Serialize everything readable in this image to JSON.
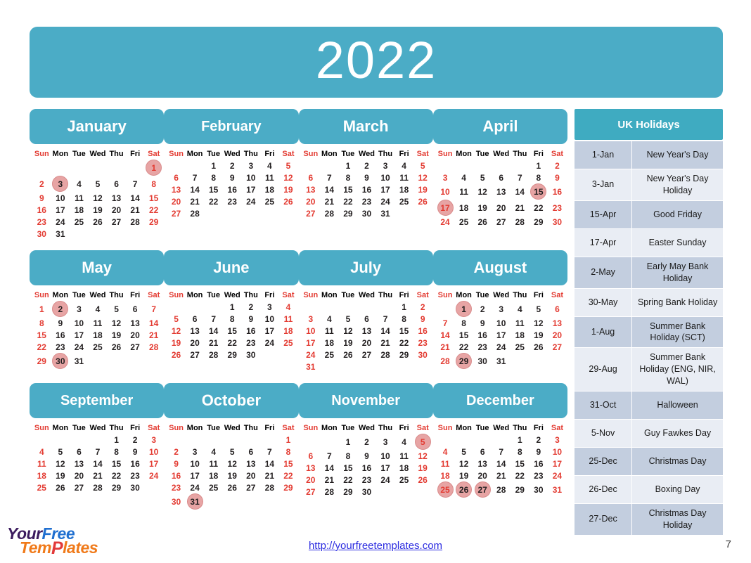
{
  "banner": {
    "year": "2022"
  },
  "weekday_headers": [
    "Sun",
    "Mon",
    "Tue",
    "Wed",
    "Thu",
    "Fri",
    "Sat"
  ],
  "months": [
    {
      "name": "January",
      "weeks": [
        [
          null,
          null,
          null,
          null,
          null,
          null,
          1
        ],
        [
          2,
          3,
          4,
          5,
          6,
          7,
          8
        ],
        [
          9,
          10,
          11,
          12,
          13,
          14,
          15
        ],
        [
          16,
          17,
          18,
          19,
          20,
          21,
          22
        ],
        [
          23,
          24,
          25,
          26,
          27,
          28,
          29
        ],
        [
          30,
          31,
          null,
          null,
          null,
          null,
          null
        ]
      ],
      "highlighted": [
        1,
        3
      ]
    },
    {
      "name": "February",
      "weeks": [
        [
          null,
          null,
          1,
          2,
          3,
          4,
          5
        ],
        [
          6,
          7,
          8,
          9,
          10,
          11,
          12
        ],
        [
          13,
          14,
          15,
          16,
          17,
          18,
          19
        ],
        [
          20,
          21,
          22,
          23,
          24,
          25,
          26
        ],
        [
          27,
          28,
          null,
          null,
          null,
          null,
          null
        ]
      ],
      "highlighted": []
    },
    {
      "name": "March",
      "weeks": [
        [
          null,
          null,
          1,
          2,
          3,
          4,
          5
        ],
        [
          6,
          7,
          8,
          9,
          10,
          11,
          12
        ],
        [
          13,
          14,
          15,
          16,
          17,
          18,
          19
        ],
        [
          20,
          21,
          22,
          23,
          24,
          25,
          26
        ],
        [
          27,
          28,
          29,
          30,
          31,
          null,
          null
        ]
      ],
      "highlighted": []
    },
    {
      "name": "April",
      "weeks": [
        [
          null,
          null,
          null,
          null,
          null,
          1,
          2
        ],
        [
          3,
          4,
          5,
          6,
          7,
          8,
          9
        ],
        [
          10,
          11,
          12,
          13,
          14,
          15,
          16
        ],
        [
          17,
          18,
          19,
          20,
          21,
          22,
          23
        ],
        [
          24,
          25,
          26,
          27,
          28,
          29,
          30
        ]
      ],
      "highlighted": [
        15,
        17
      ]
    },
    {
      "name": "May",
      "weeks": [
        [
          1,
          2,
          3,
          4,
          5,
          6,
          7
        ],
        [
          8,
          9,
          10,
          11,
          12,
          13,
          14
        ],
        [
          15,
          16,
          17,
          18,
          19,
          20,
          21
        ],
        [
          22,
          23,
          24,
          25,
          26,
          27,
          28
        ],
        [
          29,
          30,
          31,
          null,
          null,
          null,
          null
        ]
      ],
      "highlighted": [
        2,
        30
      ]
    },
    {
      "name": "June",
      "weeks": [
        [
          null,
          null,
          null,
          1,
          2,
          3,
          4
        ],
        [
          5,
          6,
          7,
          8,
          9,
          10,
          11
        ],
        [
          12,
          13,
          14,
          15,
          16,
          17,
          18
        ],
        [
          19,
          20,
          21,
          22,
          23,
          24,
          25
        ],
        [
          26,
          27,
          28,
          29,
          30,
          null,
          null
        ]
      ],
      "highlighted": []
    },
    {
      "name": "July",
      "weeks": [
        [
          null,
          null,
          null,
          null,
          null,
          1,
          2
        ],
        [
          3,
          4,
          5,
          6,
          7,
          8,
          9
        ],
        [
          10,
          11,
          12,
          13,
          14,
          15,
          16
        ],
        [
          17,
          18,
          19,
          20,
          21,
          22,
          23
        ],
        [
          24,
          25,
          26,
          27,
          28,
          29,
          30
        ],
        [
          31,
          null,
          null,
          null,
          null,
          null,
          null
        ]
      ],
      "highlighted": []
    },
    {
      "name": "August",
      "weeks": [
        [
          null,
          1,
          2,
          3,
          4,
          5,
          6
        ],
        [
          7,
          8,
          9,
          10,
          11,
          12,
          13
        ],
        [
          14,
          15,
          16,
          17,
          18,
          19,
          20
        ],
        [
          21,
          22,
          23,
          24,
          25,
          26,
          27
        ],
        [
          28,
          29,
          30,
          31,
          null,
          null,
          null
        ]
      ],
      "highlighted": [
        1,
        29
      ]
    },
    {
      "name": "September",
      "weeks": [
        [
          null,
          null,
          null,
          null,
          1,
          2,
          3
        ],
        [
          4,
          5,
          6,
          7,
          8,
          9,
          10
        ],
        [
          11,
          12,
          13,
          14,
          15,
          16,
          17
        ],
        [
          18,
          19,
          20,
          21,
          22,
          23,
          24
        ],
        [
          25,
          26,
          27,
          28,
          29,
          30,
          null
        ]
      ],
      "highlighted": []
    },
    {
      "name": "October",
      "weeks": [
        [
          null,
          null,
          null,
          null,
          null,
          null,
          1
        ],
        [
          2,
          3,
          4,
          5,
          6,
          7,
          8
        ],
        [
          9,
          10,
          11,
          12,
          13,
          14,
          15
        ],
        [
          16,
          17,
          18,
          19,
          20,
          21,
          22
        ],
        [
          23,
          24,
          25,
          26,
          27,
          28,
          29
        ],
        [
          30,
          31,
          null,
          null,
          null,
          null,
          null
        ]
      ],
      "highlighted": [
        31
      ]
    },
    {
      "name": "November",
      "weeks": [
        [
          null,
          null,
          1,
          2,
          3,
          4,
          5
        ],
        [
          6,
          7,
          8,
          9,
          10,
          11,
          12
        ],
        [
          13,
          14,
          15,
          16,
          17,
          18,
          19
        ],
        [
          20,
          21,
          22,
          23,
          24,
          25,
          26
        ],
        [
          27,
          28,
          29,
          30,
          null,
          null,
          null
        ]
      ],
      "highlighted": [
        5
      ]
    },
    {
      "name": "December",
      "weeks": [
        [
          null,
          null,
          null,
          null,
          1,
          2,
          3
        ],
        [
          4,
          5,
          6,
          7,
          8,
          9,
          10
        ],
        [
          11,
          12,
          13,
          14,
          15,
          16,
          17
        ],
        [
          18,
          19,
          20,
          21,
          22,
          23,
          24
        ],
        [
          25,
          26,
          27,
          28,
          29,
          30,
          31
        ]
      ],
      "highlighted": [
        25,
        26,
        27
      ]
    }
  ],
  "holidays": {
    "title": "UK Holidays",
    "rows": [
      {
        "date": "1-Jan",
        "name": "New Year's Day"
      },
      {
        "date": "3-Jan",
        "name": "New Year's Day Holiday"
      },
      {
        "date": "15-Apr",
        "name": "Good Friday"
      },
      {
        "date": "17-Apr",
        "name": "Easter Sunday"
      },
      {
        "date": "2-May",
        "name": "Early May Bank Holiday"
      },
      {
        "date": "30-May",
        "name": "Spring Bank Holiday"
      },
      {
        "date": "1-Aug",
        "name": "Summer Bank Holiday (SCT)"
      },
      {
        "date": "29-Aug",
        "name": "Summer Bank Holiday (ENG, NIR, WAL)"
      },
      {
        "date": "31-Oct",
        "name": "Halloween"
      },
      {
        "date": "5-Nov",
        "name": "Guy Fawkes Day"
      },
      {
        "date": "25-Dec",
        "name": "Christmas Day"
      },
      {
        "date": "26-Dec",
        "name": "Boxing Day"
      },
      {
        "date": "27-Dec",
        "name": "Christmas Day Holiday"
      }
    ]
  },
  "footer": {
    "logo_line1_a": "Your",
    "logo_line1_b": "Free",
    "logo_line2_a": "Tem",
    "logo_line2_p": "P",
    "logo_line2_b": "lates",
    "url": "http://yourfreetemplates.com",
    "page_number": "7"
  },
  "colors": {
    "banner": "#4BACC6",
    "month_header": "#4BACC6",
    "weekend_red": "#E33B32",
    "highlight_circle": "#E7A4A4",
    "holiday_row_dark": "#C3CEDF",
    "holiday_row_light": "#E9EDF4",
    "holiday_header": "#3FABC1",
    "url_link": "#2B2BE0"
  }
}
